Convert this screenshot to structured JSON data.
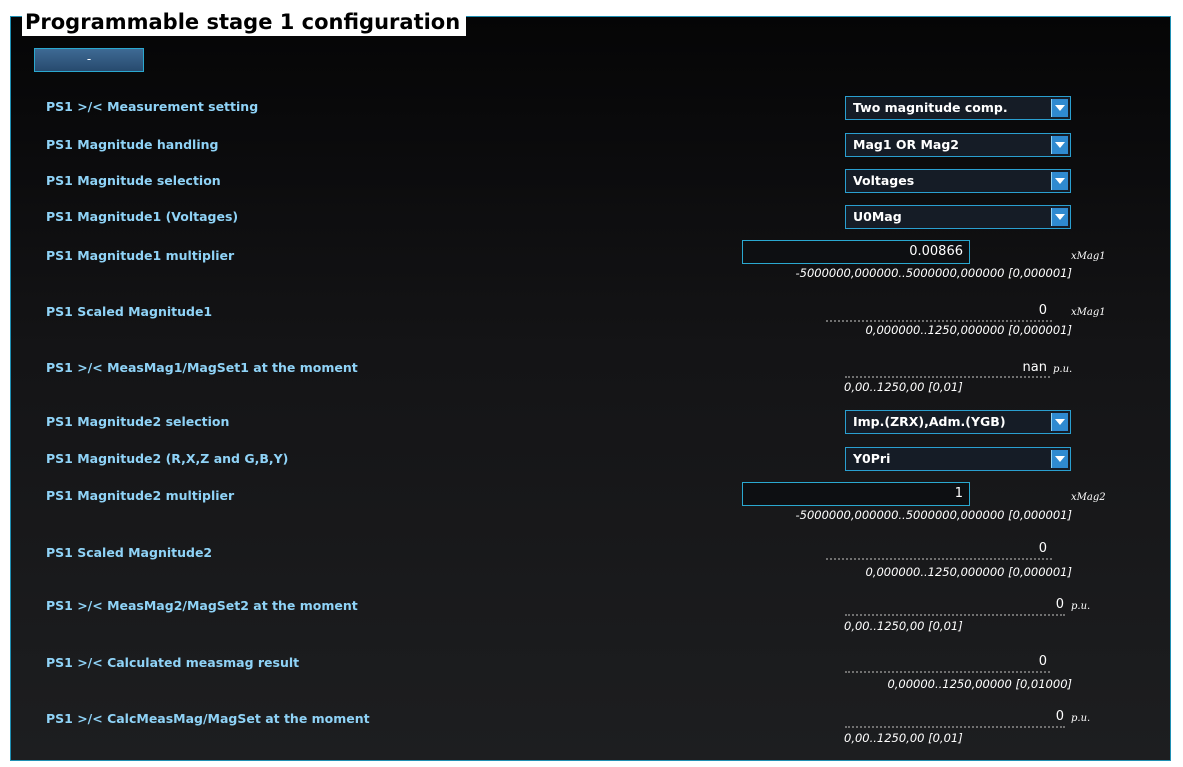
{
  "title": "Programmable stage 1 configuration",
  "collapse_button": "-",
  "rows": {
    "meas_setting": {
      "label": "PS1 >/< Measurement setting",
      "value": "Two magnitude comp."
    },
    "mag_handling": {
      "label": "PS1 Magnitude handling",
      "value": "Mag1 OR Mag2"
    },
    "mag_selection": {
      "label": "PS1 Magnitude selection",
      "value": "Voltages"
    },
    "mag1_voltages": {
      "label": "PS1 Magnitude1 (Voltages)",
      "value": "U0Mag"
    },
    "mag1_multiplier": {
      "label": "PS1 Magnitude1 multiplier",
      "value": "0.00866",
      "unit": "xMag1",
      "range": "-5000000,000000..5000000,000000 [0,000001]"
    },
    "scaled_mag1": {
      "label": "PS1 Scaled Magnitude1",
      "value": "0",
      "unit": "xMag1",
      "range": "0,000000..1250,000000 [0,000001]"
    },
    "measmag1": {
      "label": "PS1 >/< MeasMag1/MagSet1 at the moment",
      "value": "nan",
      "unit": "p.u.",
      "range": "0,00..1250,00 [0,01]"
    },
    "mag2_selection": {
      "label": "PS1 Magnitude2 selection",
      "value": "Imp.(ZRX),Adm.(YGB)"
    },
    "mag2_rxz": {
      "label": "PS1 Magnitude2 (R,X,Z and G,B,Y)",
      "value": "Y0Pri"
    },
    "mag2_multiplier": {
      "label": "PS1 Magnitude2 multiplier",
      "value": "1",
      "unit": "xMag2",
      "range": "-5000000,000000..5000000,000000 [0,000001]"
    },
    "scaled_mag2": {
      "label": "PS1 Scaled Magnitude2",
      "value": "0",
      "range": "0,000000..1250,000000 [0,000001]"
    },
    "measmag2": {
      "label": "PS1 >/< MeasMag2/MagSet2 at the moment",
      "value": "0",
      "unit": "p.u.",
      "range": "0,00..1250,00 [0,01]"
    },
    "calc_result": {
      "label": "PS1 >/< Calculated measmag result",
      "value": "0",
      "range": "0,00000..1250,00000 [0,01000]"
    },
    "calc_moment": {
      "label": "PS1 >/< CalcMeasMag/MagSet at the moment",
      "value": "0",
      "unit": "p.u.",
      "range": "0,00..1250,00 [0,01]"
    }
  },
  "colors": {
    "label": "#8fd3f7",
    "border": "#2aa8d0",
    "background": "#141416"
  }
}
